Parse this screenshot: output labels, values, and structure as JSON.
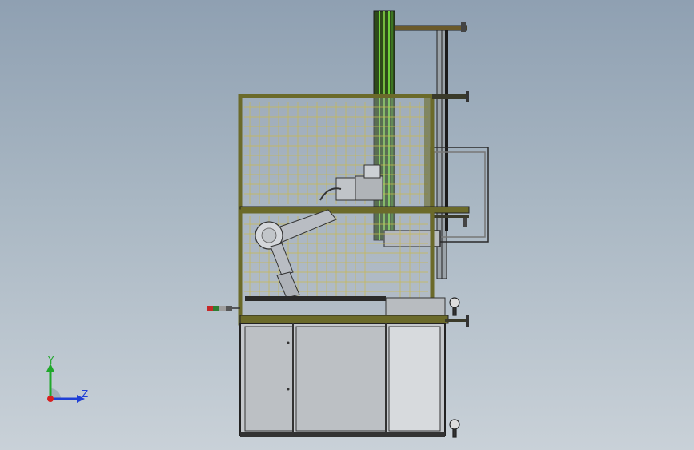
{
  "triad": {
    "y_label": "Y",
    "z_label": "Z",
    "y_color": "#1fa82a",
    "z_color": "#1f3fd6",
    "origin_color": "#d81f1f"
  },
  "colors": {
    "frame": "#6b6a2a",
    "mesh": "#c8b850",
    "column": "#2e4a1a",
    "column_stripe": "#6fd13a",
    "panel": "#c5c8cc",
    "robot": "#b9bdc3"
  },
  "scene": {
    "description_icon": "cad-assembly-robot-cell"
  }
}
